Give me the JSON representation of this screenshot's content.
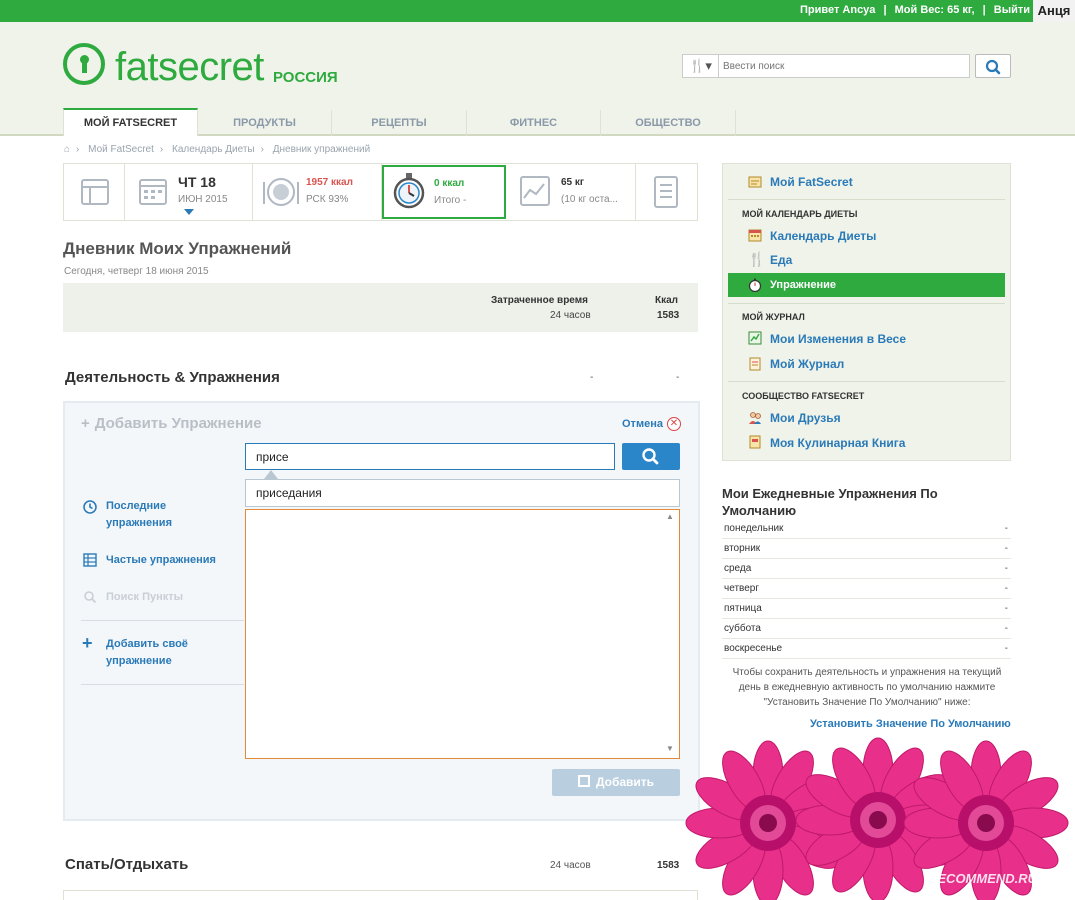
{
  "topbar": {
    "greeting": "Привет Ancya",
    "weight": "Мой Вес: 65 кг,",
    "logout": "Выйти",
    "username": "Анця",
    "sep": "|"
  },
  "header": {
    "logo_text": "fatsecret",
    "logo_sub": "РОССИЯ",
    "search_placeholder": "Ввести поиск"
  },
  "nav": {
    "tabs": [
      "МОЙ FATSECRET",
      "ПРОДУКТЫ",
      "РЕЦЕПТЫ",
      "ФИТНЕС",
      "ОБЩЕСТВО"
    ]
  },
  "breadcrumb": [
    "Мой FatSecret",
    "Календарь Диеты",
    "Дневник упражнений"
  ],
  "strip": {
    "day": "ЧТ 18",
    "month": "ИЮН 2015",
    "food_kcal": "1957 ккал",
    "food_rsk": "РСК 93%",
    "exercise_kcal": "0 ккал",
    "exercise_total": "Итого -",
    "weight": "65 кг",
    "weight_note": "(10 кг оста..."
  },
  "main": {
    "title": "Дневник Моих Упражнений",
    "subtitle": "Сегодня, четверг 18 июня 2015",
    "summary": {
      "time_label": "Затраченное время",
      "time_value": "24 часов",
      "kcal_label": "Ккал",
      "kcal_value": "1583"
    },
    "activity_title": "Деятельность & Упражнения",
    "dash": "-",
    "add_panel": {
      "title": "Добавить Упражнение",
      "cancel": "Отмена",
      "input_value": "присе",
      "suggestion_typed": "прис",
      "suggestion_rest": "едания",
      "options": {
        "recent": "Последние упражнения",
        "frequent": "Частые упражнения",
        "search_items": "Поиск Пункты",
        "add_own": "Добавить своё упражнение"
      },
      "add_button": "Добавить"
    },
    "sleep": {
      "title": "Спать/Отдыхать",
      "hours": "24 часов",
      "kcal": "1583"
    }
  },
  "sidebar": {
    "my_fatsecret": "Мой FatSecret",
    "calendar_head": "МОЙ КАЛЕНДАРЬ ДИЕТЫ",
    "calendar": "Календарь Диеты",
    "food": "Еда",
    "exercise": "Упражнение",
    "journal_head": "МОЙ ЖУРНАЛ",
    "weight_changes": "Мои Изменения в Весе",
    "journal": "Мой Журнал",
    "community_head": "СООБЩЕСТВО FATSECRET",
    "friends": "Мои Друзья",
    "cookbook": "Моя Кулинарная Книга"
  },
  "defaults": {
    "title": "Мои Ежедневные Упражнения По Умолчанию",
    "days": [
      {
        "day": "понедельник",
        "value": "-"
      },
      {
        "day": "вторник",
        "value": "-"
      },
      {
        "day": "среда",
        "value": "-"
      },
      {
        "day": "четверг",
        "value": "-"
      },
      {
        "day": "пятница",
        "value": "-"
      },
      {
        "day": "суббота",
        "value": "-"
      },
      {
        "day": "воскресенье",
        "value": "-"
      }
    ],
    "note": "Чтобы сохранить деятельность и упражнения на текущий день в ежедневную активность по умолчанию нажмите \"Установить Значение По Умолчанию\" ниже:",
    "link": "Установить Значение По Умолчанию"
  },
  "watermark": "RECOMMEND.RU",
  "colors": {
    "brand_green": "#2eaa3f",
    "link_blue": "#2a7ab8",
    "flower_pink": "#e8308a"
  }
}
